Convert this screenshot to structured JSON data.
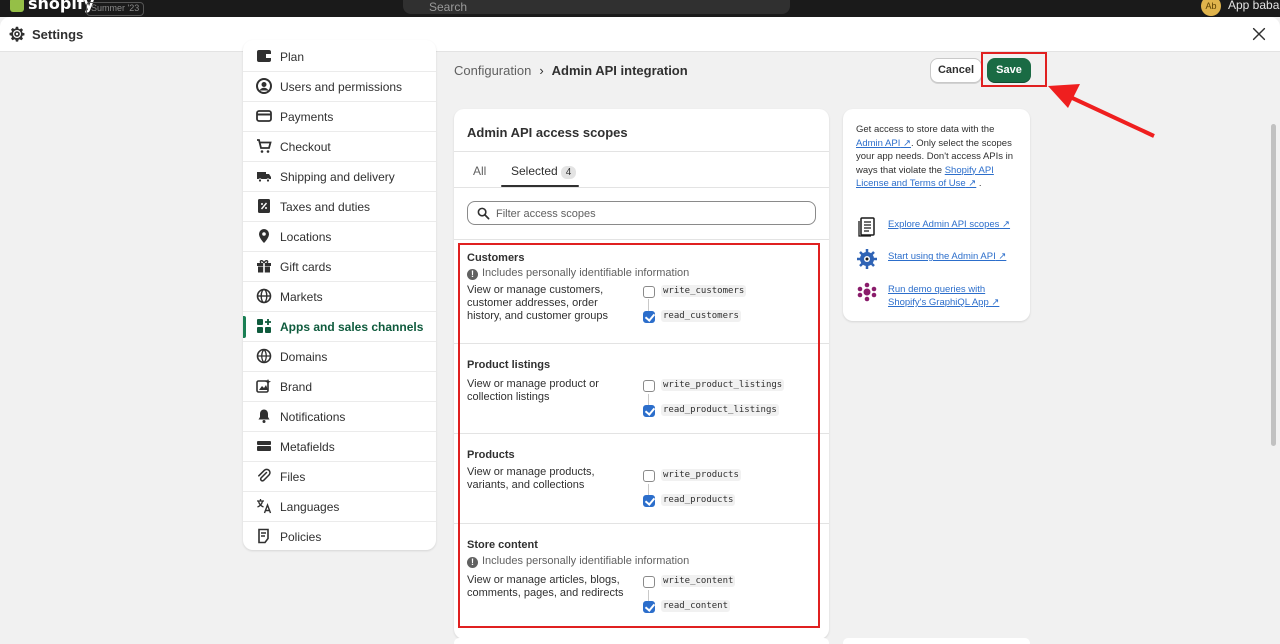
{
  "topbar": {
    "logo": "shopify",
    "store_badge": "Summer '23",
    "search_placeholder": "Search",
    "avatar_initials": "Ab",
    "user_name": "App baba"
  },
  "settings": {
    "title": "Settings"
  },
  "nav": {
    "items": [
      {
        "label": "Plan",
        "icon": "plan-icon"
      },
      {
        "label": "Users and permissions",
        "icon": "user-icon"
      },
      {
        "label": "Payments",
        "icon": "payments-icon"
      },
      {
        "label": "Checkout",
        "icon": "cart-icon"
      },
      {
        "label": "Shipping and delivery",
        "icon": "truck-icon"
      },
      {
        "label": "Taxes and duties",
        "icon": "tax-icon"
      },
      {
        "label": "Locations",
        "icon": "location-icon"
      },
      {
        "label": "Gift cards",
        "icon": "gift-icon"
      },
      {
        "label": "Markets",
        "icon": "globe-icon"
      },
      {
        "label": "Apps and sales channels",
        "icon": "apps-icon"
      },
      {
        "label": "Domains",
        "icon": "domains-icon"
      },
      {
        "label": "Brand",
        "icon": "brand-icon"
      },
      {
        "label": "Notifications",
        "icon": "bell-icon"
      },
      {
        "label": "Metafields",
        "icon": "metafields-icon"
      },
      {
        "label": "Files",
        "icon": "paperclip-icon"
      },
      {
        "label": "Languages",
        "icon": "language-icon"
      },
      {
        "label": "Policies",
        "icon": "policy-icon"
      }
    ],
    "active": "Apps and sales channels"
  },
  "breadcrumb": {
    "parent": "Configuration",
    "current": "Admin API integration"
  },
  "actions": {
    "cancel": "Cancel",
    "save": "Save"
  },
  "scopes_card": {
    "title": "Admin API access scopes",
    "tab_all": "All",
    "tab_selected": "Selected",
    "selected_count": "4",
    "filter_placeholder": "Filter access scopes",
    "sections": [
      {
        "title": "Customers",
        "pii": "Includes personally identifiable information",
        "description": "View or manage customers, customer addresses, order history, and customer groups",
        "write": {
          "scope": "write_customers",
          "checked": false
        },
        "read": {
          "scope": "read_customers",
          "checked": true
        }
      },
      {
        "title": "Product listings",
        "pii": "",
        "description": "View or manage product or collection listings",
        "write": {
          "scope": "write_product_listings",
          "checked": false
        },
        "read": {
          "scope": "read_product_listings",
          "checked": true
        }
      },
      {
        "title": "Products",
        "pii": "",
        "description": "View or manage products, variants, and collections",
        "write": {
          "scope": "write_products",
          "checked": false
        },
        "read": {
          "scope": "read_products",
          "checked": true
        }
      },
      {
        "title": "Store content",
        "pii": "Includes personally identifiable information",
        "description": "View or manage articles, blogs, comments, pages, and redirects",
        "write": {
          "scope": "write_content",
          "checked": false
        },
        "read": {
          "scope": "read_content",
          "checked": true
        }
      }
    ]
  },
  "info_card": {
    "text_1": "Get access to store data with the",
    "link_admin_api": "Admin API",
    "text_2": ". Only select the scopes your app needs. Don't access APIs in ways that violate the",
    "link_license": "Shopify API License and Terms of Use",
    "text_3": ".",
    "resources": [
      {
        "label": "Explore Admin API scopes",
        "icon": "document-icon"
      },
      {
        "label": "Start using the Admin API",
        "icon": "gears-icon"
      },
      {
        "label": "Run demo queries with Shopify's GraphiQL App",
        "icon": "graphql-icon"
      }
    ]
  },
  "colors": {
    "accent_green": "#1a6b44",
    "highlight_red": "#e02020",
    "link_blue": "#2c6ecb"
  }
}
